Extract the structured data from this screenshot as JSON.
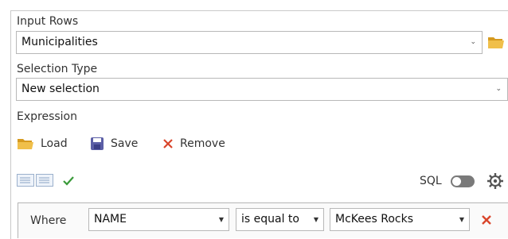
{
  "input_rows": {
    "label": "Input Rows",
    "value": "Municipalities",
    "chevron": "⌄"
  },
  "selection_type": {
    "label": "Selection Type",
    "value": "New selection",
    "chevron": "⌄"
  },
  "expression": {
    "label": "Expression"
  },
  "toolbar": {
    "load_label": "Load",
    "save_label": "Save",
    "remove_label": "Remove",
    "sql_label": "SQL"
  },
  "clause": {
    "where_label": "Where",
    "field": "NAME",
    "operator": "is equal to",
    "value": "McKees Rocks",
    "arrow": "▼"
  },
  "colors": {
    "folder": "#e8b23a",
    "save_icon": "#5b5ea6",
    "remove_icon": "#d9452b",
    "check": "#3a9a3a"
  },
  "icons": [
    "folder-icon",
    "save-disk-icon",
    "remove-x-icon",
    "switch-view-icon",
    "checkmark-icon",
    "gear-icon",
    "delete-clause-icon"
  ]
}
